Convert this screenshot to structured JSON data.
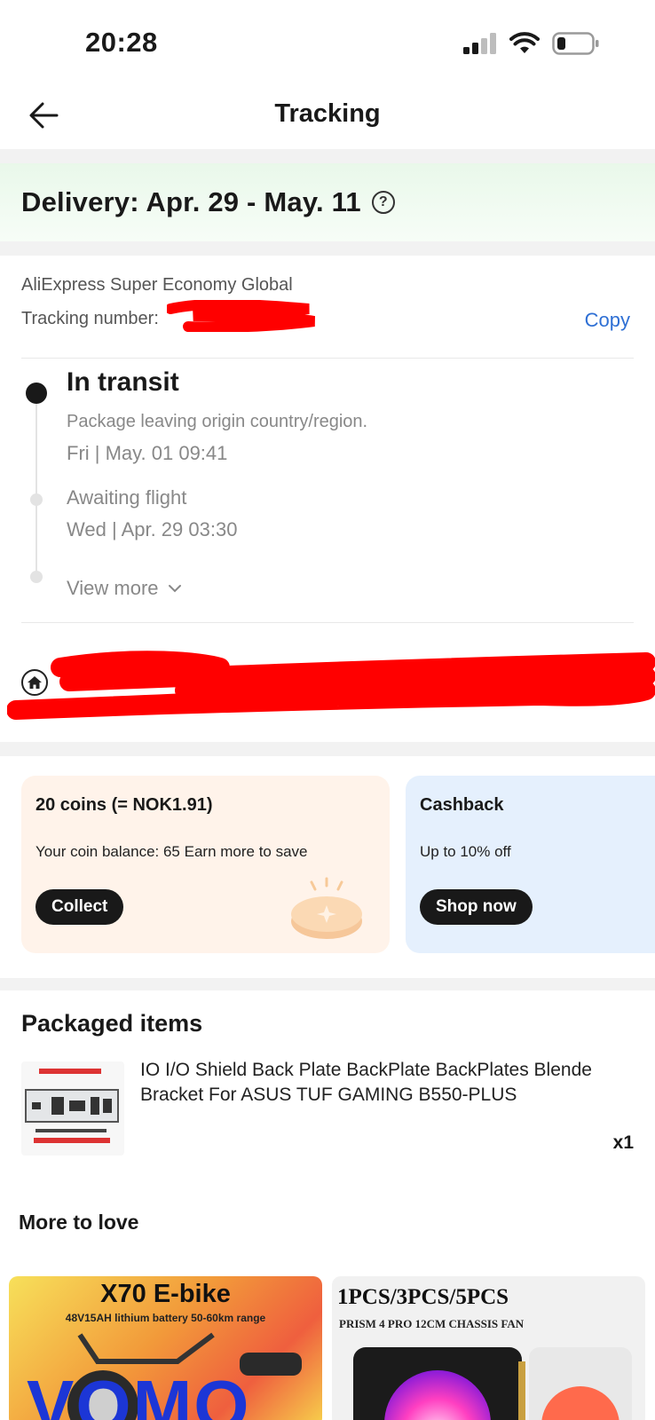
{
  "status_bar": {
    "time": "20:28"
  },
  "header": {
    "title": "Tracking"
  },
  "delivery": {
    "title": "Delivery: Apr. 29 - May. 11"
  },
  "carrier": {
    "name": "AliExpress Super Economy Global",
    "tracking_label": "Tracking number:",
    "copy_label": "Copy"
  },
  "timeline": {
    "current": {
      "status": "In transit",
      "detail": "Package leaving origin country/region.",
      "time": "Fri | May. 01 09:41"
    },
    "previous": {
      "status": "Awaiting flight",
      "time": "Wed | Apr. 29 03:30"
    },
    "view_more": "View more"
  },
  "promos": {
    "coins": {
      "title": "20 coins (= NOK1.91)",
      "subtitle": "Your coin balance: 65 Earn more to save",
      "button": "Collect"
    },
    "cashback": {
      "title": "Cashback",
      "subtitle": "Up to 10% off",
      "button": "Shop now"
    }
  },
  "packaged": {
    "title": "Packaged items",
    "item": {
      "name": "IO I/O Shield Back Plate BackPlate BackPlates Blende Bracket For ASUS TUF GAMING B550-PLUS",
      "qty": "x1"
    }
  },
  "more_to_love": {
    "title": "More to love",
    "cards": [
      {
        "headline": "X70 E-bike",
        "sub": "48V15AH lithium battery 50-60km range",
        "brand": "VOMO"
      },
      {
        "headline": "1PCS/3PCS/5PCS",
        "sub": "PRISM 4 PRO 12CM CHASSIS FAN"
      }
    ]
  },
  "colors": {
    "accent_link": "#2e6fd4",
    "delivery_bg": "#e9f8ea",
    "coins_bg": "#fff3ea",
    "cashback_bg": "#e5f0fd"
  }
}
